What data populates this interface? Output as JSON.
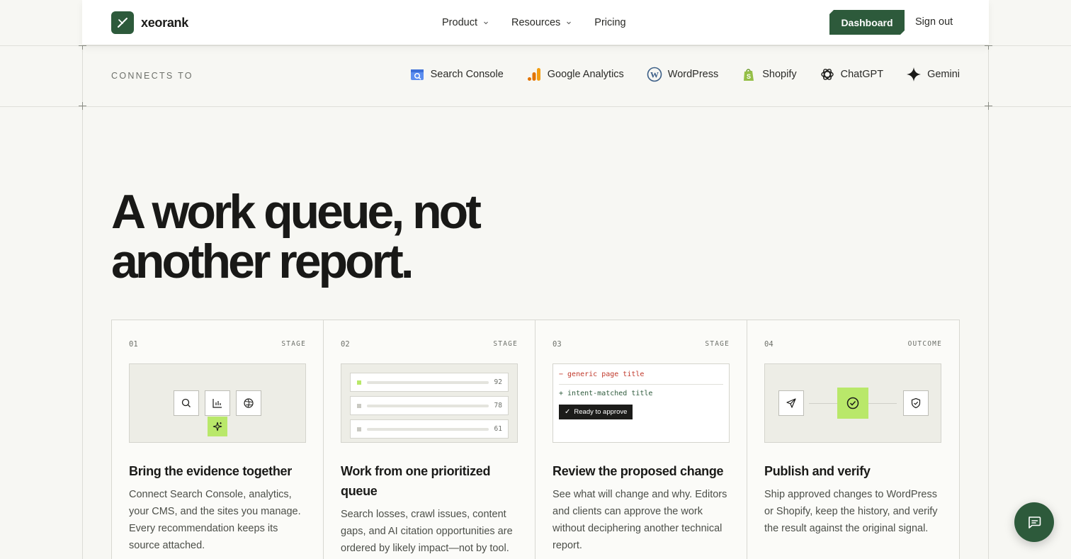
{
  "brand": {
    "name": "xeorank"
  },
  "nav": {
    "items": [
      {
        "label": "Product",
        "has_dropdown": true
      },
      {
        "label": "Resources",
        "has_dropdown": true
      },
      {
        "label": "Pricing",
        "has_dropdown": false
      }
    ],
    "dashboard_label": "Dashboard",
    "signout_label": "Sign out"
  },
  "connects": {
    "label": "CONNECTS TO",
    "integrations": [
      {
        "name": "Search Console",
        "icon": "search-console-icon"
      },
      {
        "name": "Google Analytics",
        "icon": "google-analytics-icon"
      },
      {
        "name": "WordPress",
        "icon": "wordpress-icon"
      },
      {
        "name": "Shopify",
        "icon": "shopify-icon"
      },
      {
        "name": "ChatGPT",
        "icon": "chatgpt-icon"
      },
      {
        "name": "Gemini",
        "icon": "gemini-icon"
      }
    ]
  },
  "hero": {
    "line1": "A work queue, not",
    "line2": "another report."
  },
  "cards": [
    {
      "num": "01",
      "tag": "STAGE",
      "title": "Bring the evidence together",
      "desc": "Connect Search Console, analytics, your CMS, and the sites you manage. Every recommendation keeps its source attached."
    },
    {
      "num": "02",
      "tag": "STAGE",
      "title": "Work from one prioritized queue",
      "desc": "Search losses, crawl issues, content gaps, and AI citation opportunities are ordered by likely impact—not by tool.",
      "queue_scores": [
        "92",
        "78",
        "61"
      ]
    },
    {
      "num": "03",
      "tag": "STAGE",
      "title": "Review the proposed change",
      "desc": "See what will change and why. Editors and clients can approve the work without deciphering another technical report.",
      "diff_minus": "− generic page title",
      "diff_plus": "+ intent-matched title",
      "approve_label": "Ready to approve"
    },
    {
      "num": "04",
      "tag": "OUTCOME",
      "title": "Publish and verify",
      "desc": "Ship approved changes to WordPress or Shopify, keep the history, and verify the result against the original signal."
    }
  ],
  "colors": {
    "brand_green": "#2d5a3b",
    "accent_lime": "#b9e86a",
    "background": "#f7f7f3",
    "diff_red": "#c0392b"
  }
}
